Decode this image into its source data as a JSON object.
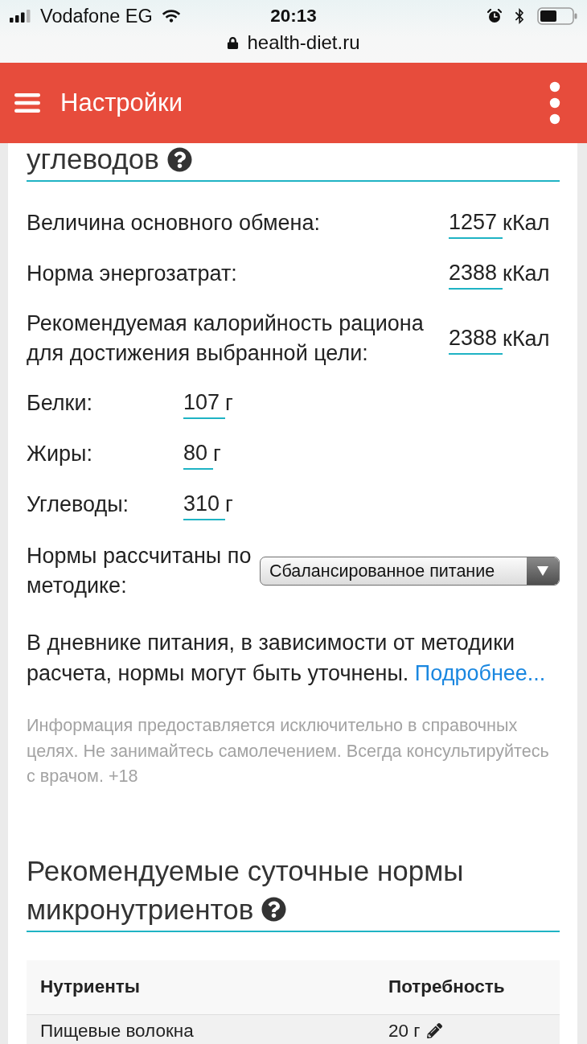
{
  "status_bar": {
    "carrier": "Vodafone EG",
    "time": "20:13",
    "url": "health-diet.ru"
  },
  "app_bar": {
    "title": "Настройки"
  },
  "energy_section": {
    "heading": "углеводов",
    "energy_rows": [
      {
        "label": "Величина основного обмена:",
        "value": "1257",
        "unit": "кКал"
      },
      {
        "label": "Норма энергозатрат:",
        "value": "2388",
        "unit": "кКал"
      },
      {
        "label": "Рекомендуемая калорийность рациона для достижения выбранной цели:",
        "value": "2388",
        "unit": "кКал"
      }
    ],
    "macro_rows": [
      {
        "label": "Белки:",
        "value": "107",
        "unit": "г"
      },
      {
        "label": "Жиры:",
        "value": "80",
        "unit": "г"
      },
      {
        "label": "Углеводы:",
        "value": "310",
        "unit": "г"
      }
    ],
    "method": {
      "label": "Нормы рассчитаны по методике:",
      "value": "Сбалансированное питание"
    },
    "note": {
      "text": "В дневнике питания, в зависимости от методики расчета, нормы могут быть уточнены.",
      "link": "Подробнее..."
    },
    "disclaimer": "Информация предоставляется исключительно в справочных целях. Не занимайтесь самолечением. Всегда консультируйтесь с врачом. +18"
  },
  "micronutrients": {
    "heading_lines": [
      "Рекомендуемые суточные нормы",
      "микронутриентов"
    ],
    "table": {
      "columns": [
        "Нутриенты",
        "Потребность"
      ],
      "rows": [
        {
          "nutrient": "Пищевые волокна",
          "amount": "20 г"
        }
      ]
    }
  }
}
